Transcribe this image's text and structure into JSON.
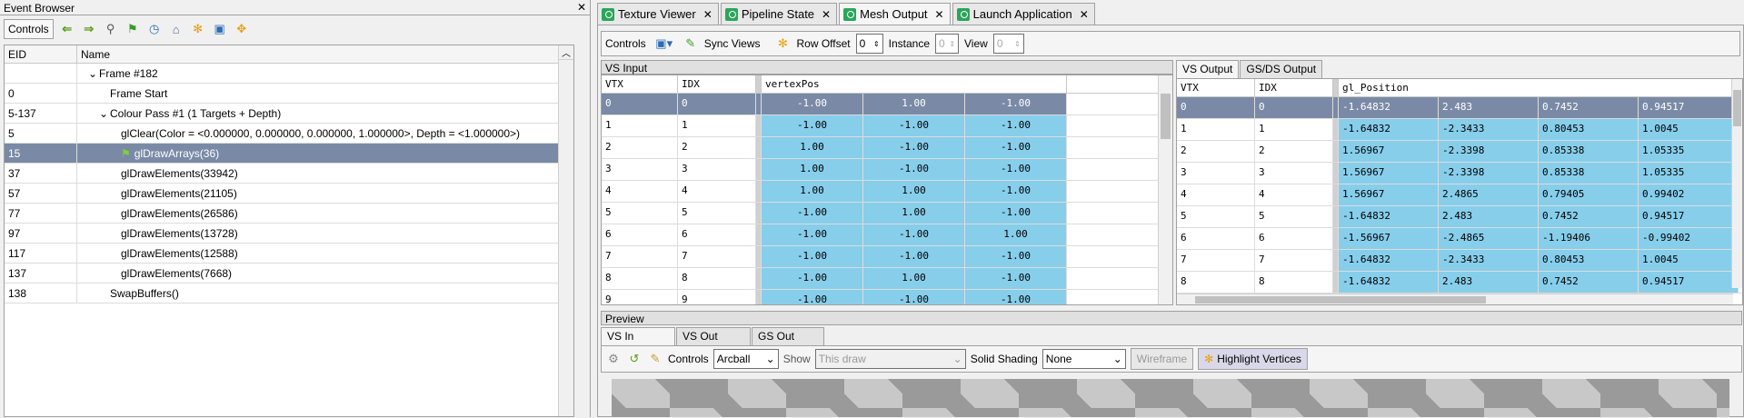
{
  "event_browser": {
    "title": "Event Browser",
    "close": "✕",
    "controls_label": "Controls",
    "columns": [
      "EID",
      "Name"
    ],
    "rows": [
      {
        "eid": "",
        "name": "Frame #182",
        "indent": 1,
        "expander": "v"
      },
      {
        "eid": "0",
        "name": "Frame Start",
        "indent": 2,
        "expander": ""
      },
      {
        "eid": "5-137",
        "name": "Colour Pass #1 (1 Targets + Depth)",
        "indent": 2,
        "expander": "v"
      },
      {
        "eid": "5",
        "name": "glClear(Color = <0.000000, 0.000000, 0.000000, 1.000000>, Depth = <1.000000>)",
        "indent": 3,
        "expander": ""
      },
      {
        "eid": "15",
        "name": "glDrawArrays(36)",
        "indent": 3,
        "expander": "",
        "selected": true,
        "flag": true
      },
      {
        "eid": "37",
        "name": "glDrawElements(33942)",
        "indent": 3,
        "expander": ""
      },
      {
        "eid": "57",
        "name": "glDrawElements(21105)",
        "indent": 3,
        "expander": ""
      },
      {
        "eid": "77",
        "name": "glDrawElements(26586)",
        "indent": 3,
        "expander": ""
      },
      {
        "eid": "97",
        "name": "glDrawElements(13728)",
        "indent": 3,
        "expander": ""
      },
      {
        "eid": "117",
        "name": "glDrawElements(12588)",
        "indent": 3,
        "expander": ""
      },
      {
        "eid": "137",
        "name": "glDrawElements(7668)",
        "indent": 3,
        "expander": ""
      },
      {
        "eid": "138",
        "name": "SwapBuffers()",
        "indent": 2,
        "expander": ""
      }
    ]
  },
  "tabs": [
    {
      "label": "Texture Viewer",
      "close": "✕"
    },
    {
      "label": "Pipeline State",
      "close": "✕"
    },
    {
      "label": "Mesh Output",
      "close": "✕",
      "active": true
    },
    {
      "label": "Launch Application",
      "close": "✕"
    }
  ],
  "mesh_toolbar": {
    "controls_label": "Controls",
    "sync_views": "Sync Views",
    "row_offset_label": "Row Offset",
    "row_offset_value": "0",
    "instance_label": "Instance",
    "instance_value": "0",
    "view_label": "View",
    "view_value": "0"
  },
  "vs_input": {
    "title": "VS Input",
    "columns": [
      "VTX",
      "IDX",
      "vertexPos"
    ],
    "rows": [
      [
        "0",
        "0",
        "-1.00",
        "1.00",
        "-1.00"
      ],
      [
        "1",
        "1",
        "-1.00",
        "-1.00",
        "-1.00"
      ],
      [
        "2",
        "2",
        "1.00",
        "-1.00",
        "-1.00"
      ],
      [
        "3",
        "3",
        "1.00",
        "-1.00",
        "-1.00"
      ],
      [
        "4",
        "4",
        "1.00",
        "1.00",
        "-1.00"
      ],
      [
        "5",
        "5",
        "-1.00",
        "1.00",
        "-1.00"
      ],
      [
        "6",
        "6",
        "-1.00",
        "-1.00",
        "1.00"
      ],
      [
        "7",
        "7",
        "-1.00",
        "-1.00",
        "-1.00"
      ],
      [
        "8",
        "8",
        "-1.00",
        "1.00",
        "-1.00"
      ],
      [
        "9",
        "9",
        "-1.00",
        "-1.00",
        "-1.00"
      ]
    ]
  },
  "vs_output": {
    "tabs": [
      "VS Output",
      "GS/DS Output"
    ],
    "columns": [
      "VTX",
      "IDX",
      "gl_Position"
    ],
    "rows": [
      [
        "0",
        "0",
        "-1.64832",
        "2.483",
        "0.7452",
        "0.94517"
      ],
      [
        "1",
        "1",
        "-1.64832",
        "-2.3433",
        "0.80453",
        "1.0045"
      ],
      [
        "2",
        "2",
        "1.56967",
        "-2.3398",
        "0.85338",
        "1.05335"
      ],
      [
        "3",
        "3",
        "1.56967",
        "-2.3398",
        "0.85338",
        "1.05335"
      ],
      [
        "4",
        "4",
        "1.56967",
        "2.4865",
        "0.79405",
        "0.99402"
      ],
      [
        "5",
        "5",
        "-1.64832",
        "2.483",
        "0.7452",
        "0.94517"
      ],
      [
        "6",
        "6",
        "-1.56967",
        "-2.4865",
        "-1.19406",
        "-0.99402"
      ],
      [
        "7",
        "7",
        "-1.64832",
        "-2.3433",
        "0.80453",
        "1.0045"
      ],
      [
        "8",
        "8",
        "-1.64832",
        "2.483",
        "0.7452",
        "0.94517"
      ]
    ]
  },
  "preview": {
    "title": "Preview",
    "tabs": [
      "VS In",
      "VS Out",
      "GS Out"
    ],
    "controls_label": "Controls",
    "controls_value": "Arcball",
    "show_label": "Show",
    "show_value": "This draw",
    "shading_label": "Solid Shading",
    "shading_value": "None",
    "wireframe": "Wireframe",
    "highlight": "Highlight Vertices"
  },
  "colors": {
    "selection": "#7a8aa6",
    "cell_blue": "#87ceeb",
    "tab_icon": "#2aa65a"
  }
}
